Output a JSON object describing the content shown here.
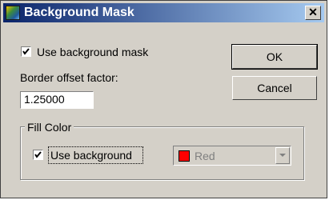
{
  "window": {
    "title": "Background Mask",
    "close_glyph": "✕"
  },
  "use_mask": {
    "label": "Use background mask",
    "checked": true
  },
  "border_offset": {
    "label": "Border offset factor:",
    "value": "1.25000"
  },
  "buttons": {
    "ok": "OK",
    "cancel": "Cancel"
  },
  "fill_color": {
    "title": "Fill Color",
    "use_background": {
      "label": "Use background",
      "checked": true
    },
    "color_select": {
      "value": "Red",
      "swatch": "#ff0000",
      "enabled": false
    }
  },
  "icons": {
    "app": "app-icon",
    "close": "close-icon",
    "check": "checkmark-icon",
    "dropdown": "chevron-down-icon"
  }
}
